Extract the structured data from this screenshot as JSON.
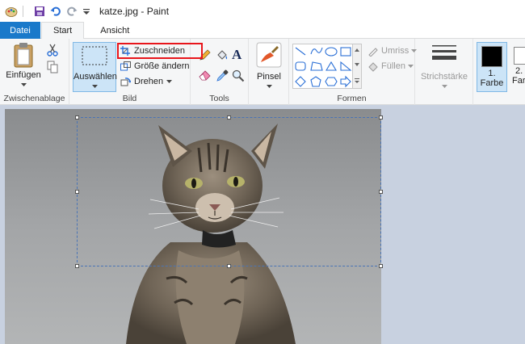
{
  "title": "katze.jpg - Paint",
  "tabs": {
    "file": "Datei",
    "start": "Start",
    "view": "Ansicht"
  },
  "clipboard": {
    "paste": "Einfügen",
    "group": "Zwischenablage"
  },
  "image": {
    "select": "Auswählen",
    "crop": "Zuschneiden",
    "resize": "Größe ändern",
    "rotate": "Drehen",
    "group": "Bild"
  },
  "tools": {
    "group": "Tools"
  },
  "brushes": {
    "label": "Pinsel"
  },
  "shapes": {
    "outline": "Umriss",
    "fill": "Füllen",
    "group": "Formen"
  },
  "size": {
    "label": "Strichstärke"
  },
  "colors": {
    "color1_line1": "1.",
    "color1_line2": "Farbe",
    "color2_line1": "2.",
    "color2_line2": "Farb",
    "color1_value": "#000000"
  },
  "accent": "#1979ca"
}
